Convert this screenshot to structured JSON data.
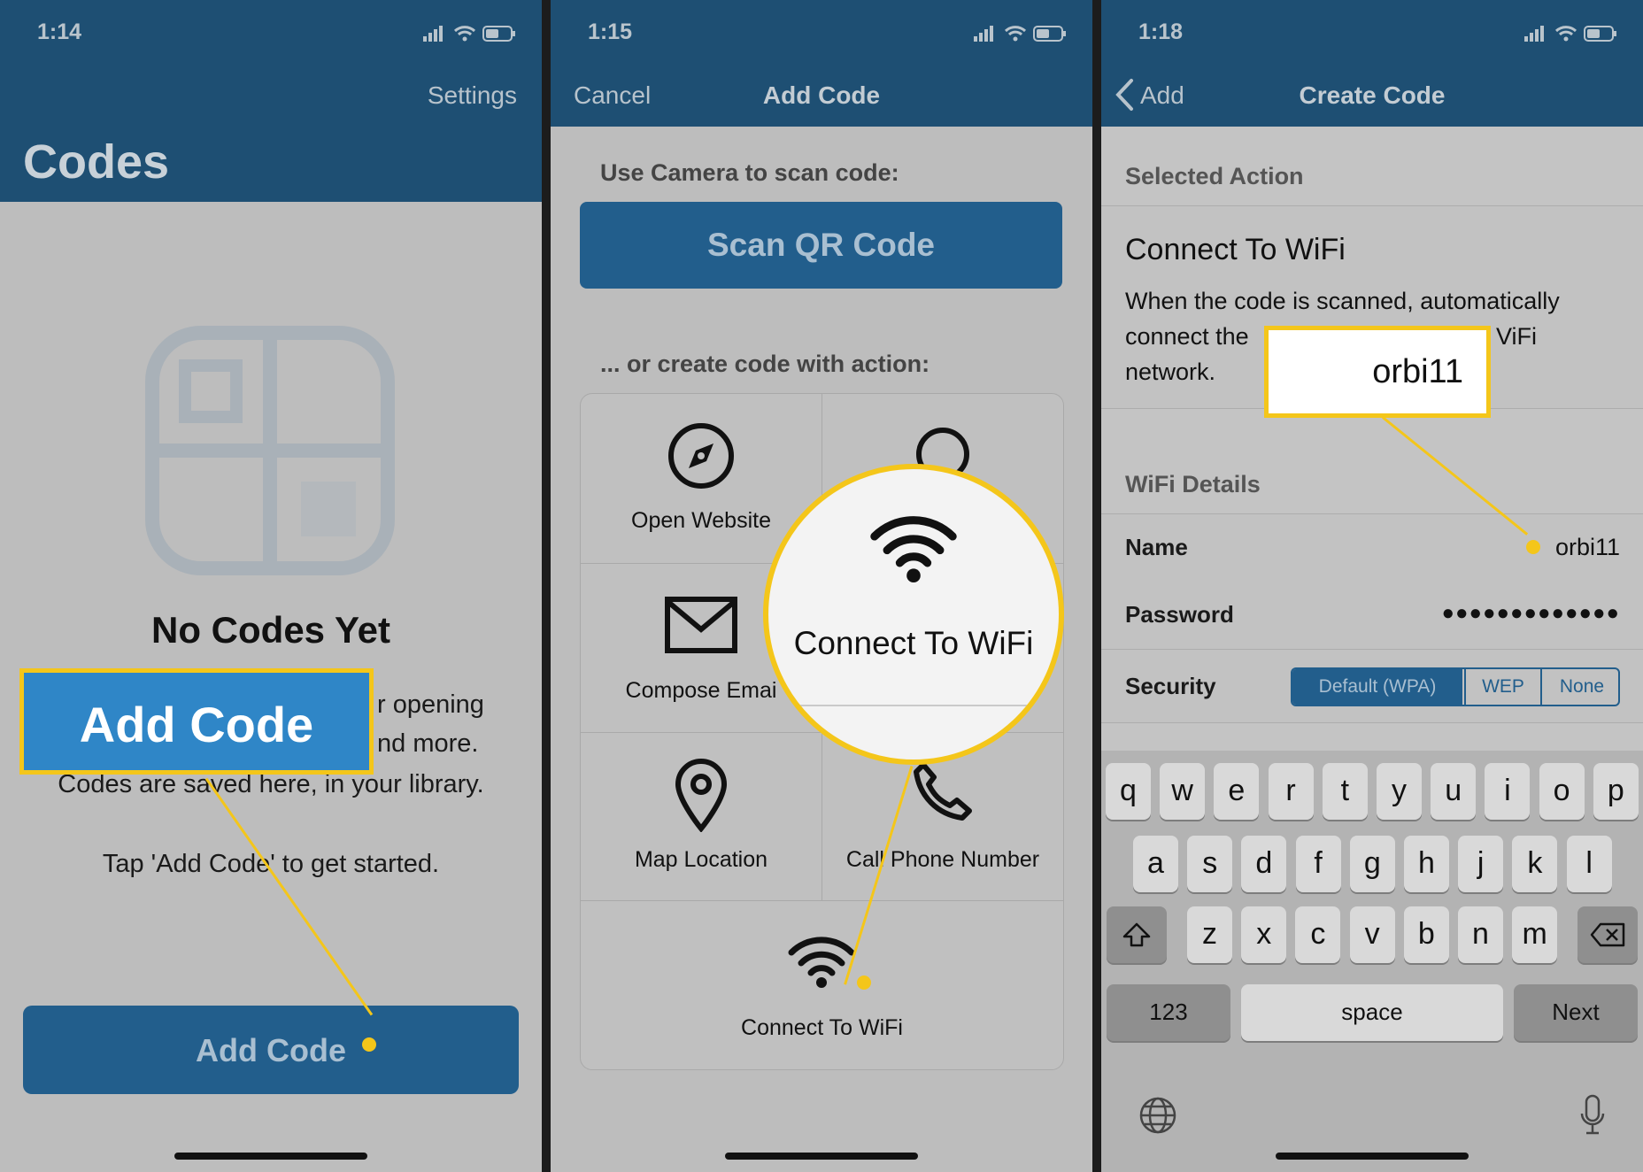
{
  "panel1": {
    "time": "1:14",
    "settings": "Settings",
    "title": "Codes",
    "empty_title": "No Codes Yet",
    "desc_line1": "r opening",
    "desc_line2": "nd more.",
    "desc_line3": "Codes are saved here, in your library.",
    "hint": "Tap 'Add Code' to get started.",
    "button": "Add Code",
    "callout": "Add Code"
  },
  "panel2": {
    "time": "1:15",
    "cancel": "Cancel",
    "title": "Add Code",
    "camera_label": "Use Camera to scan code:",
    "scan_button": "Scan QR Code",
    "create_label": "... or create code with action:",
    "actions": [
      {
        "label": "Open Website",
        "icon": "compass-icon"
      },
      {
        "label": "Compose Emai",
        "icon": "envelope-icon"
      },
      {
        "label": "Map Location",
        "icon": "map-pin-icon"
      },
      {
        "label": "Call Phone Number",
        "icon": "phone-icon"
      },
      {
        "label": "Connect To WiFi",
        "icon": "wifi-icon"
      }
    ],
    "magnifier_label": "Connect To WiFi"
  },
  "panel3": {
    "time": "1:18",
    "back": "Add",
    "title": "Create Code",
    "selected_action_header": "Selected Action",
    "action_title": "Connect To WiFi",
    "action_desc_line1": "When the code is scanned, automatically",
    "action_desc_line2a": "connect the",
    "action_desc_line2b": "ViFi",
    "action_desc_line3": "network.",
    "wifi_details_header": "WiFi Details",
    "name_label": "Name",
    "name_value": "orbi11",
    "password_label": "Password",
    "password_value": "●●●●●●●●●●●●●",
    "security_label": "Security",
    "security_options": [
      "Default (WPA)",
      "WEP",
      "None"
    ],
    "callout": "orbi11",
    "keyboard": {
      "row1": [
        "q",
        "w",
        "e",
        "r",
        "t",
        "y",
        "u",
        "i",
        "o",
        "p"
      ],
      "row2": [
        "a",
        "s",
        "d",
        "f",
        "g",
        "h",
        "j",
        "k",
        "l"
      ],
      "row3": [
        "z",
        "x",
        "c",
        "v",
        "b",
        "n",
        "m"
      ],
      "numbers": "123",
      "space": "space",
      "next": "Next"
    }
  },
  "colors": {
    "header": "#1e4f73",
    "button": "#225e8c",
    "callout": "#f4c61a",
    "callout_fill": "#2f86c7"
  }
}
